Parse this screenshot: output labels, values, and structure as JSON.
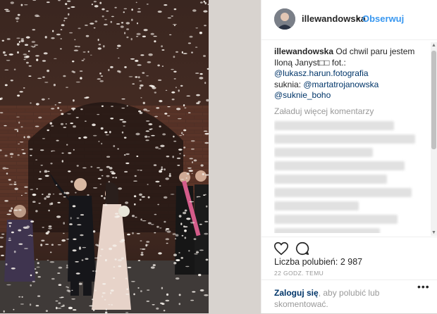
{
  "header": {
    "username": "illewandowska",
    "separator": "•",
    "follow_label": "Obserwuj"
  },
  "caption": {
    "username": "illewandowska",
    "text": "Od chwil paru jestem Iloną Janyst□□ fot.:",
    "mention_photographer": "@lukasz.harun.fotografia",
    "dress_label": "suknia: ",
    "mention_dress1": "@martatrojanowska",
    "mention_dress2": "@suknie_boho"
  },
  "load_more_label": "Załaduj więcej komentarzy",
  "likes": {
    "label": "Liczba polubień: 2 987"
  },
  "timestamp": "22 GODZ. TEMU",
  "login": {
    "link_label": "Zaloguj się",
    "rest_text": ", aby polubić lub skomentować."
  },
  "more_label": "•••",
  "colors": {
    "accent": "#3897f0",
    "link": "#003569",
    "muted": "#999999",
    "backdrop": "#d8d3cf"
  }
}
